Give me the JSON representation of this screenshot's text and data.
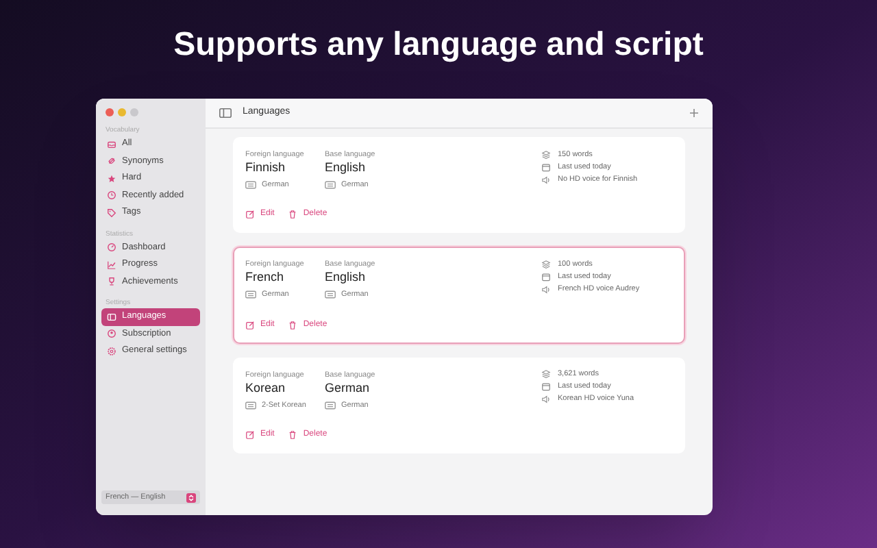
{
  "headline": "Supports any language and script",
  "sidebar": {
    "sections": [
      {
        "heading": "Vocabulary",
        "items": [
          {
            "label": "All",
            "selected": false
          },
          {
            "label": "Synonyms",
            "selected": false
          },
          {
            "label": "Hard",
            "selected": false
          },
          {
            "label": "Recently added",
            "selected": false
          },
          {
            "label": "Tags",
            "selected": false
          }
        ]
      },
      {
        "heading": "Statistics",
        "items": [
          {
            "label": "Dashboard",
            "selected": false
          },
          {
            "label": "Progress",
            "selected": false
          },
          {
            "label": "Achievements",
            "selected": false
          }
        ]
      },
      {
        "heading": "Settings",
        "items": [
          {
            "label": "Languages",
            "selected": true
          },
          {
            "label": "Subscription",
            "selected": false
          },
          {
            "label": "General settings",
            "selected": false
          }
        ]
      }
    ],
    "language_picker": "French — English"
  },
  "toolbar": {
    "title": "Languages"
  },
  "languages": [
    {
      "foreign_label": "Foreign language",
      "foreign": "Finnish",
      "foreign_keyboard": "German",
      "base_label": "Base language",
      "base": "English",
      "base_keyboard": "German",
      "words": "150 words",
      "last_used": "Last used today",
      "voice": "No HD voice for Finnish",
      "selected": false,
      "actions": [
        "Edit",
        "Delete"
      ]
    },
    {
      "foreign_label": "Foreign language",
      "foreign": "French",
      "foreign_keyboard": "German",
      "base_label": "Base language",
      "base": "English",
      "base_keyboard": "German",
      "words": "100 words",
      "last_used": "Last used today",
      "voice": "French HD voice Audrey",
      "selected": true,
      "actions": [
        "Edit",
        "Delete"
      ]
    },
    {
      "foreign_label": "Foreign language",
      "foreign": "Korean",
      "foreign_keyboard": "2-Set Korean",
      "base_label": "Base language",
      "base": "German",
      "base_keyboard": "German",
      "words": "3,621 words",
      "last_used": "Last used today",
      "voice": "Korean HD voice Yuna",
      "selected": false,
      "actions": [
        "Edit",
        "Delete"
      ]
    }
  ]
}
